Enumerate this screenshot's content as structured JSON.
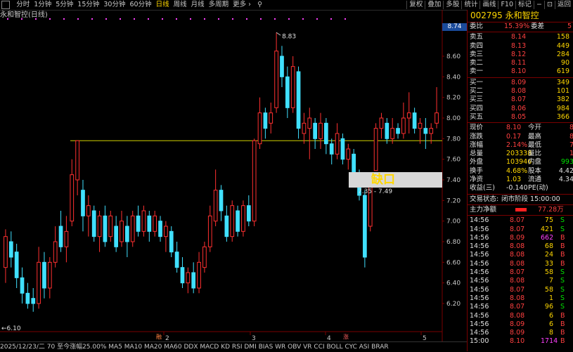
{
  "toolbar": {
    "periods": [
      "分时",
      "1分钟",
      "5分钟",
      "15分钟",
      "30分钟",
      "60分钟",
      "日线",
      "周线",
      "月线",
      "多周期",
      "更多 ›"
    ],
    "active_period": "日线",
    "right_items": [
      "复权",
      "叠加",
      "多股",
      "统计",
      "画线",
      "F10",
      "标记",
      "−",
      "⊡",
      "返回"
    ]
  },
  "chart_title": "永和智控(日线)",
  "price_tag": "8.74",
  "high_label": "8.83",
  "low_label": "6.10",
  "gap": {
    "label": "缺口",
    "range": "7.35 - 7.49"
  },
  "markers": {
    "left": "融",
    "right": "涨"
  },
  "axis": {
    "y_ticks": [
      "8.60",
      "8.40",
      "8.20",
      "8.00",
      "7.80",
      "7.60",
      "7.40",
      "7.20",
      "7.00",
      "6.80",
      "6.60",
      "6.40",
      "6.20"
    ],
    "x_ticks": [
      "2",
      "3",
      "4",
      "5"
    ]
  },
  "bottom_bar": "2025/12/23/二 70  至今涨幅25.00%    MA5 MA10 MA20 MA60 DDX MACD KD RSI DMI BIAS WR OBV VR CCI BOLL CYC ASI BRAR",
  "stock": {
    "code": "002795",
    "name": "永和智控"
  },
  "orderbook": {
    "weibi": {
      "label": "委比",
      "value": "15.39%",
      "label2": "委差",
      "value2": "5"
    },
    "asks": [
      {
        "label": "卖五",
        "price": "8.14",
        "vol": "158"
      },
      {
        "label": "卖四",
        "price": "8.13",
        "vol": "449"
      },
      {
        "label": "卖三",
        "price": "8.12",
        "vol": "284"
      },
      {
        "label": "卖二",
        "price": "8.11",
        "vol": "90"
      },
      {
        "label": "卖一",
        "price": "8.10",
        "vol": "619"
      }
    ],
    "bids": [
      {
        "label": "买一",
        "price": "8.09",
        "vol": "349"
      },
      {
        "label": "买二",
        "price": "8.08",
        "vol": "101"
      },
      {
        "label": "买三",
        "price": "8.07",
        "vol": "382"
      },
      {
        "label": "买四",
        "price": "8.06",
        "vol": "984"
      },
      {
        "label": "买五",
        "price": "8.05",
        "vol": "366"
      }
    ]
  },
  "quote": [
    {
      "l1": "现价",
      "v1": "8.10",
      "l2": "今开",
      "v2": "8"
    },
    {
      "l1": "涨跌",
      "v1": "0.17",
      "l2": "最高",
      "v2": "8"
    },
    {
      "l1": "涨幅",
      "v1": "2.14%",
      "l2": "最低",
      "v2": "7"
    },
    {
      "l1": "总量",
      "v1": "203338",
      "l2": "量比",
      "v2": "1"
    },
    {
      "l1": "外盘",
      "v1": "103946",
      "l2": "内盘",
      "v2": "993"
    },
    {
      "l1": "换手",
      "v1": "4.68%",
      "l2": "股本",
      "v2": "4.42"
    },
    {
      "l1": "净资",
      "v1": "1.03",
      "l2": "流通",
      "v2": "4.34"
    },
    {
      "l1": "收益(三)",
      "v1": "-0.140",
      "l2": "PE(动)",
      "v2": ""
    }
  ],
  "status": {
    "label": "交易状态:",
    "value": "闭市阶段 15:00:00"
  },
  "main_flow": {
    "label": "主力净额",
    "value": "77.28万"
  },
  "ticks": [
    {
      "t": "14:56",
      "p": "8.07",
      "v": "75",
      "s": "S"
    },
    {
      "t": "14:56",
      "p": "8.07",
      "v": "421",
      "s": "S"
    },
    {
      "t": "14:56",
      "p": "8.09",
      "v": "662",
      "s": "B"
    },
    {
      "t": "14:56",
      "p": "8.08",
      "v": "68",
      "s": "B"
    },
    {
      "t": "14:56",
      "p": "8.08",
      "v": "24",
      "s": "B"
    },
    {
      "t": "14:56",
      "p": "8.08",
      "v": "33",
      "s": "B"
    },
    {
      "t": "14:56",
      "p": "8.07",
      "v": "58",
      "s": "S"
    },
    {
      "t": "14:56",
      "p": "8.08",
      "v": "7",
      "s": "S"
    },
    {
      "t": "14:56",
      "p": "8.07",
      "v": "58",
      "s": "S"
    },
    {
      "t": "14:56",
      "p": "8.08",
      "v": "1",
      "s": "S"
    },
    {
      "t": "14:56",
      "p": "8.07",
      "v": "96",
      "s": "S"
    },
    {
      "t": "14:56",
      "p": "8.08",
      "v": "6",
      "s": "B"
    },
    {
      "t": "14:56",
      "p": "8.09",
      "v": "6",
      "s": "B"
    },
    {
      "t": "14:56",
      "p": "8.09",
      "v": "8",
      "s": "B"
    },
    {
      "t": "15:00",
      "p": "8.10",
      "v": "1714",
      "s": "B"
    }
  ],
  "chart_data": {
    "type": "candlestick",
    "title": "永和智控(日线)",
    "ylim": [
      6.1,
      8.9
    ],
    "high": 8.83,
    "low": 6.1,
    "last": 8.1,
    "hline": 7.78,
    "gap": [
      7.35,
      7.49
    ],
    "candles": [
      {
        "o": 6.55,
        "c": 6.85,
        "h": 6.92,
        "l": 6.4
      },
      {
        "o": 6.8,
        "c": 6.65,
        "h": 6.9,
        "l": 6.55
      },
      {
        "o": 6.7,
        "c": 6.45,
        "h": 6.78,
        "l": 6.35
      },
      {
        "o": 6.45,
        "c": 6.3,
        "h": 6.55,
        "l": 6.2
      },
      {
        "o": 6.3,
        "c": 6.2,
        "h": 6.4,
        "l": 6.15
      },
      {
        "o": 6.25,
        "c": 6.2,
        "h": 6.35,
        "l": 6.12
      },
      {
        "o": 6.2,
        "c": 6.6,
        "h": 6.75,
        "l": 6.15
      },
      {
        "o": 6.6,
        "c": 6.35,
        "h": 6.7,
        "l": 6.25
      },
      {
        "o": 6.35,
        "c": 6.6,
        "h": 6.65,
        "l": 6.25
      },
      {
        "o": 6.6,
        "c": 6.8,
        "h": 6.95,
        "l": 6.55
      },
      {
        "o": 6.95,
        "c": 6.75,
        "h": 7.1,
        "l": 6.7
      },
      {
        "o": 6.75,
        "c": 6.9,
        "h": 7.05,
        "l": 6.6
      },
      {
        "o": 7.0,
        "c": 7.45,
        "h": 7.6,
        "l": 6.95
      },
      {
        "o": 7.4,
        "c": 7.78,
        "h": 7.78,
        "l": 7.25
      },
      {
        "o": 7.3,
        "c": 7.05,
        "h": 7.4,
        "l": 6.9
      },
      {
        "o": 7.05,
        "c": 7.15,
        "h": 7.25,
        "l": 6.85
      },
      {
        "o": 7.1,
        "c": 6.85,
        "h": 7.15,
        "l": 6.8
      },
      {
        "o": 6.85,
        "c": 7.05,
        "h": 7.1,
        "l": 6.7
      },
      {
        "o": 7.05,
        "c": 6.8,
        "h": 7.15,
        "l": 6.75
      },
      {
        "o": 6.85,
        "c": 7.05,
        "h": 7.1,
        "l": 6.8
      },
      {
        "o": 6.95,
        "c": 6.75,
        "h": 7.05,
        "l": 6.7
      },
      {
        "o": 6.8,
        "c": 7.0,
        "h": 7.1,
        "l": 6.75
      },
      {
        "o": 6.95,
        "c": 6.8,
        "h": 7.05,
        "l": 6.65
      },
      {
        "o": 6.8,
        "c": 7.05,
        "h": 7.1,
        "l": 6.75
      },
      {
        "o": 7.05,
        "c": 6.9,
        "h": 7.15,
        "l": 6.85
      },
      {
        "o": 6.9,
        "c": 7.1,
        "h": 7.15,
        "l": 6.85
      },
      {
        "o": 7.05,
        "c": 6.9,
        "h": 7.1,
        "l": 6.8
      },
      {
        "o": 6.9,
        "c": 7.05,
        "h": 7.1,
        "l": 6.85
      },
      {
        "o": 7.0,
        "c": 6.85,
        "h": 7.05,
        "l": 6.8
      },
      {
        "o": 6.85,
        "c": 6.95,
        "h": 7.0,
        "l": 6.7
      },
      {
        "o": 6.9,
        "c": 6.7,
        "h": 6.95,
        "l": 6.65
      },
      {
        "o": 6.7,
        "c": 6.55,
        "h": 6.8,
        "l": 6.5
      },
      {
        "o": 6.55,
        "c": 6.4,
        "h": 6.65,
        "l": 6.35
      },
      {
        "o": 6.4,
        "c": 6.5,
        "h": 6.55,
        "l": 6.3
      },
      {
        "o": 6.5,
        "c": 6.35,
        "h": 6.6,
        "l": 6.3
      },
      {
        "o": 6.35,
        "c": 6.6,
        "h": 6.7,
        "l": 6.3
      },
      {
        "o": 6.55,
        "c": 6.75,
        "h": 6.8,
        "l": 6.5
      },
      {
        "o": 6.75,
        "c": 7.05,
        "h": 7.15,
        "l": 6.7
      },
      {
        "o": 7.0,
        "c": 7.3,
        "h": 7.5,
        "l": 6.95
      },
      {
        "o": 7.3,
        "c": 7.1,
        "h": 7.35,
        "l": 7.0
      },
      {
        "o": 7.05,
        "c": 6.85,
        "h": 7.15,
        "l": 6.8
      },
      {
        "o": 6.85,
        "c": 7.15,
        "h": 7.2,
        "l": 6.8
      },
      {
        "o": 7.1,
        "c": 6.9,
        "h": 7.15,
        "l": 6.85
      },
      {
        "o": 6.9,
        "c": 7.15,
        "h": 7.2,
        "l": 6.85
      },
      {
        "o": 7.15,
        "c": 7.0,
        "h": 7.25,
        "l": 6.95
      },
      {
        "o": 7.0,
        "c": 7.78,
        "h": 7.8,
        "l": 6.95
      },
      {
        "o": 7.75,
        "c": 8.05,
        "h": 8.2,
        "l": 7.7
      },
      {
        "o": 8.05,
        "c": 7.9,
        "h": 8.1,
        "l": 7.8
      },
      {
        "o": 7.95,
        "c": 8.05,
        "h": 8.15,
        "l": 7.85
      },
      {
        "o": 8.1,
        "c": 8.65,
        "h": 8.83,
        "l": 8.05
      },
      {
        "o": 8.6,
        "c": 8.4,
        "h": 8.7,
        "l": 8.3
      },
      {
        "o": 8.4,
        "c": 8.1,
        "h": 8.5,
        "l": 8.0
      },
      {
        "o": 8.1,
        "c": 8.5,
        "h": 8.6,
        "l": 8.05
      },
      {
        "o": 8.45,
        "c": 7.9,
        "h": 8.5,
        "l": 7.8
      },
      {
        "o": 7.85,
        "c": 7.95,
        "h": 8.05,
        "l": 7.75
      },
      {
        "o": 7.9,
        "c": 8.0,
        "h": 8.1,
        "l": 7.6
      },
      {
        "o": 7.95,
        "c": 7.8,
        "h": 8.0,
        "l": 7.7
      },
      {
        "o": 7.8,
        "c": 7.95,
        "h": 8.05,
        "l": 7.7
      },
      {
        "o": 7.95,
        "c": 7.75,
        "h": 8.0,
        "l": 7.65
      },
      {
        "o": 7.75,
        "c": 7.65,
        "h": 7.8,
        "l": 7.55
      },
      {
        "o": 7.65,
        "c": 7.85,
        "h": 7.95,
        "l": 7.6
      },
      {
        "o": 7.8,
        "c": 7.6,
        "h": 7.85,
        "l": 7.55
      },
      {
        "o": 7.6,
        "c": 7.7,
        "h": 7.75,
        "l": 7.5
      },
      {
        "o": 7.65,
        "c": 7.45,
        "h": 7.7,
        "l": 7.4
      },
      {
        "o": 7.45,
        "c": 7.25,
        "h": 7.5,
        "l": 7.2
      },
      {
        "o": 7.25,
        "c": 6.65,
        "h": 7.3,
        "l": 6.55
      },
      {
        "o": 6.95,
        "c": 7.35,
        "h": 7.35,
        "l": 6.9
      },
      {
        "o": 7.49,
        "c": 7.9,
        "h": 7.95,
        "l": 7.49
      },
      {
        "o": 7.9,
        "c": 8.0,
        "h": 8.05,
        "l": 7.8
      },
      {
        "o": 7.95,
        "c": 7.8,
        "h": 8.0,
        "l": 7.75
      },
      {
        "o": 7.8,
        "c": 7.9,
        "h": 8.0,
        "l": 7.75
      },
      {
        "o": 7.9,
        "c": 7.85,
        "h": 7.95,
        "l": 7.8
      },
      {
        "o": 7.85,
        "c": 8.0,
        "h": 8.15,
        "l": 7.8
      },
      {
        "o": 8.0,
        "c": 8.05,
        "h": 8.25,
        "l": 7.85
      },
      {
        "o": 8.05,
        "c": 7.9,
        "h": 8.1,
        "l": 7.85
      },
      {
        "o": 7.9,
        "c": 7.95,
        "h": 8.0,
        "l": 7.75
      },
      {
        "o": 7.9,
        "c": 7.85,
        "h": 8.0,
        "l": 7.7
      },
      {
        "o": 7.85,
        "c": 7.9,
        "h": 7.95,
        "l": 7.75
      },
      {
        "o": 7.95,
        "c": 8.05,
        "h": 8.3,
        "l": 7.9
      }
    ]
  }
}
